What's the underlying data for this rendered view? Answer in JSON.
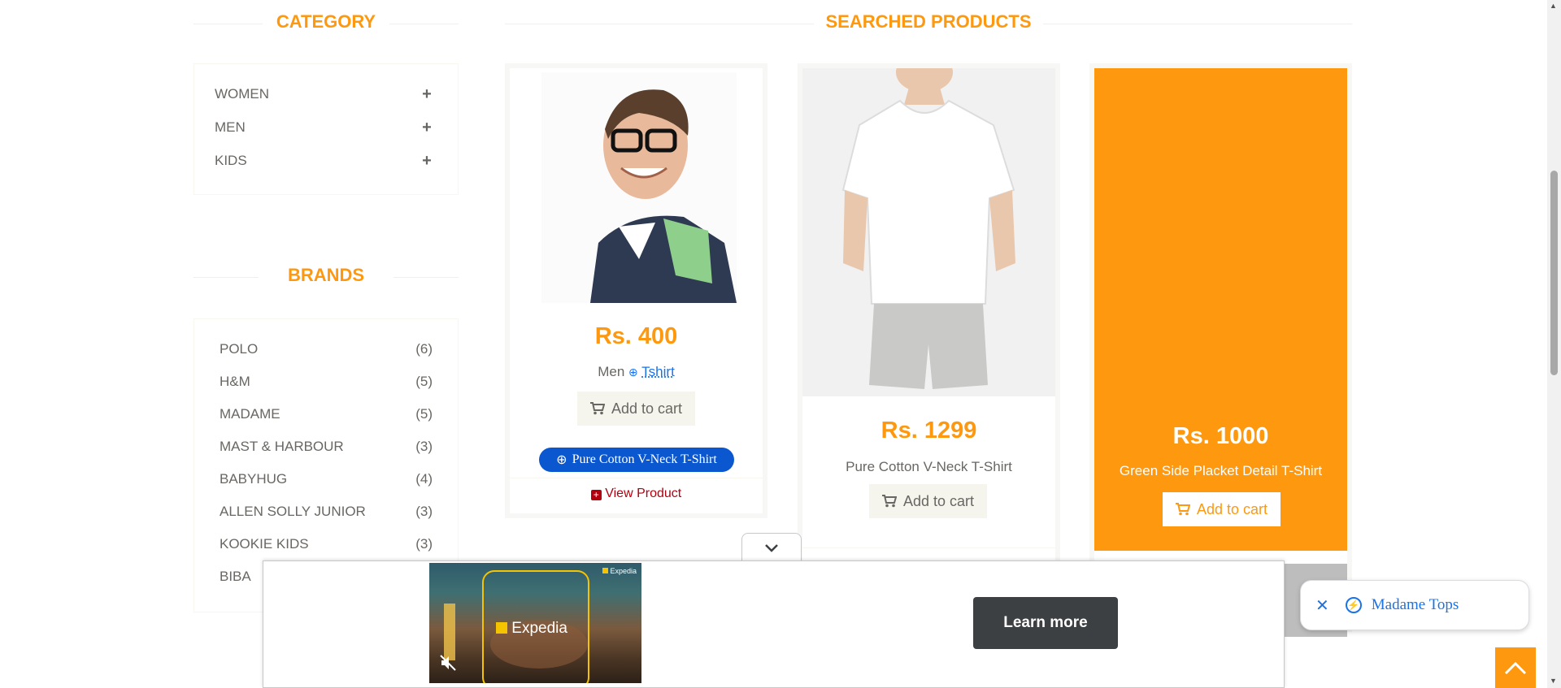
{
  "sidebar": {
    "category_title": "CATEGORY",
    "categories": [
      {
        "label": "WOMEN",
        "expand": "+"
      },
      {
        "label": "MEN",
        "expand": "+"
      },
      {
        "label": "KIDS",
        "expand": "+"
      }
    ],
    "brands_title": "BRANDS",
    "brands": [
      {
        "name": "POLO",
        "count": "(6)"
      },
      {
        "name": "H&M",
        "count": "(5)"
      },
      {
        "name": "MADAME",
        "count": "(5)"
      },
      {
        "name": "MAST & HARBOUR",
        "count": "(3)"
      },
      {
        "name": "BABYHUG",
        "count": "(4)"
      },
      {
        "name": "ALLEN SOLLY JUNIOR",
        "count": "(3)"
      },
      {
        "name": "KOOKIE KIDS",
        "count": "(3)"
      },
      {
        "name": "BIBA",
        "count": ""
      }
    ]
  },
  "main": {
    "title": "SEARCHED PRODUCTS",
    "products": [
      {
        "price": "Rs. 400",
        "category": "Men",
        "subcategory": "Tshirt",
        "add_to_cart": "Add to cart",
        "tooltip": "Pure Cotton V-Neck T-Shirt",
        "view_product": "View Product"
      },
      {
        "price": "Rs. 1299",
        "name": "Pure Cotton V-Neck T-Shirt",
        "add_to_cart": "Add to cart"
      },
      {
        "price": "Rs. 1000",
        "name": "Green Side Placket Detail T-Shirt",
        "add_to_cart": "Add to cart"
      }
    ]
  },
  "ad": {
    "brand": "Expedia",
    "cta": "Learn more"
  },
  "chip": {
    "label": "Madame Tops"
  },
  "colors": {
    "accent": "#fe980f",
    "text": "#696763",
    "link_blue": "#1a73e8",
    "pill_blue": "#0b57d0",
    "ad_button": "#3c4043"
  }
}
